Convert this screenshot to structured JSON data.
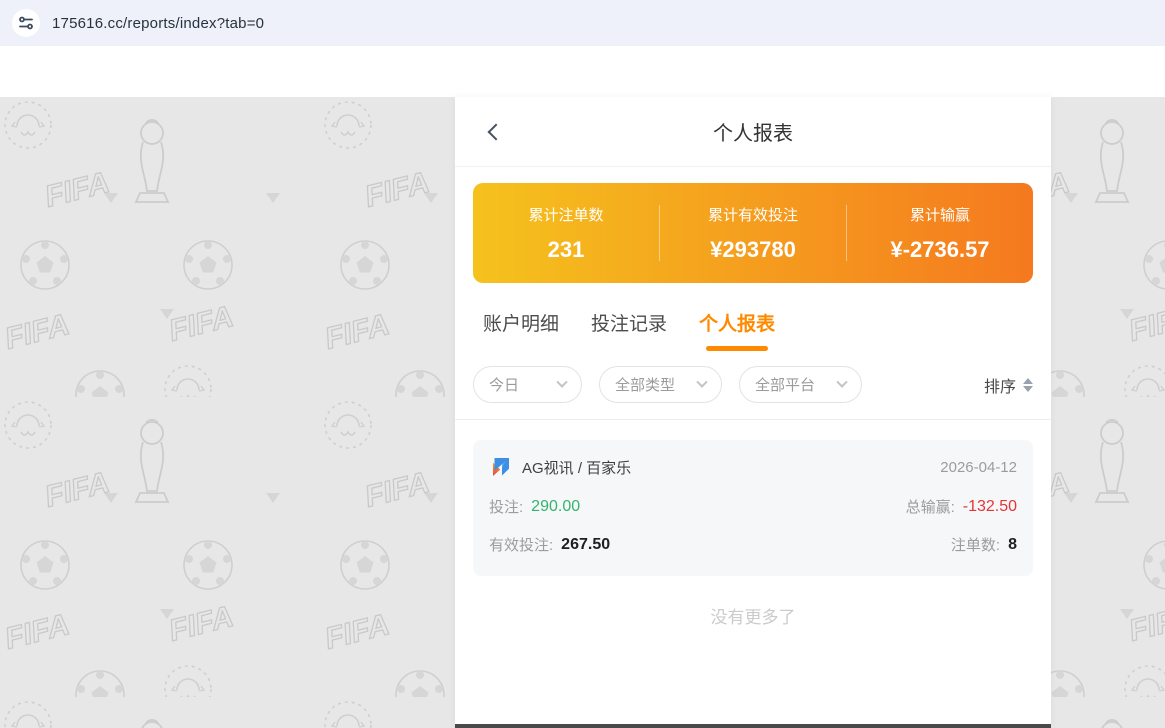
{
  "browser": {
    "url": "175616.cc/reports/index?tab=0",
    "icon": "site-settings-icon"
  },
  "header": {
    "title": "个人报表",
    "back_icon": "chevron-left-icon"
  },
  "summary": {
    "items": [
      {
        "label": "累计注单数",
        "value": "231"
      },
      {
        "label": "累计有效投注",
        "value": "¥293780"
      },
      {
        "label": "累计输赢",
        "value": "¥-2736.57"
      }
    ]
  },
  "tabs": [
    {
      "label": "账户明细",
      "active": false
    },
    {
      "label": "投注记录",
      "active": false
    },
    {
      "label": "个人报表",
      "active": true
    }
  ],
  "filters": {
    "dropdowns": [
      {
        "label": "今日",
        "icon": "chevron-down-icon"
      },
      {
        "label": "全部类型",
        "icon": "chevron-down-icon"
      },
      {
        "label": "全部平台",
        "icon": "chevron-down-icon"
      }
    ],
    "sort_label": "排序",
    "sort_icon": "sort-arrows-icon"
  },
  "report": {
    "provider_icon": "ag-logo-icon",
    "provider": "AG视讯 / 百家乐",
    "date": "2026-04-12",
    "bet_label": "投注:",
    "bet_value": "290.00",
    "win_label": "总输赢:",
    "win_value": "-132.50",
    "valid_label": "有效投注:",
    "valid_value": "267.50",
    "count_label": "注单数:",
    "count_value": "8"
  },
  "footer": {
    "no_more": "没有更多了"
  },
  "colors": {
    "accent": "#ff8a00",
    "summary_gradient_start": "#f5c21d",
    "summary_gradient_end": "#f5791f",
    "positive": "#34b46e",
    "negative": "#e53535",
    "browser_bar_bg": "#eef1fa",
    "pattern_bg": "#e7e7e7"
  }
}
